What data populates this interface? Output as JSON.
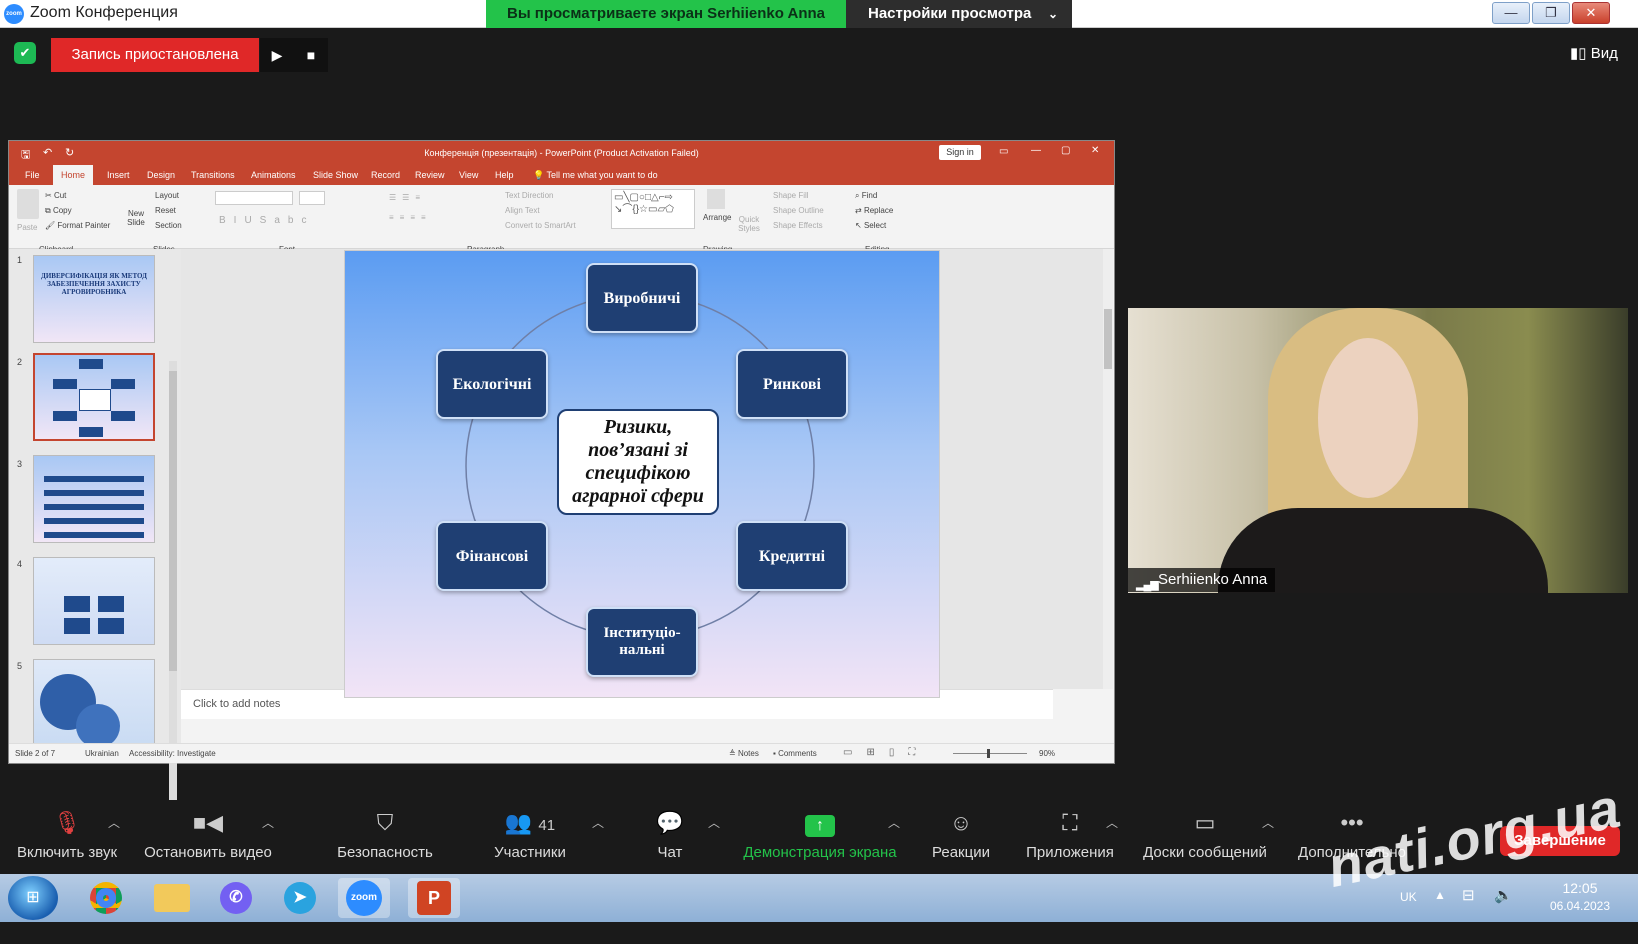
{
  "zoom": {
    "window_title": "Zoom Конференция",
    "logo_text": "zoom",
    "share_banner": "Вы просматриваете экран Serhiienko Anna",
    "view_options": "Настройки просмотра",
    "recording_status": "Запись приостановлена",
    "view_button": "Вид",
    "participant_name": "Serhiienko Anna",
    "participants_count": "41",
    "end_button": "Завершение",
    "toolbar": [
      {
        "label": "Включить звук",
        "icon": "mic-muted-icon"
      },
      {
        "label": "Остановить видео",
        "icon": "video-icon"
      },
      {
        "label": "Безопасность",
        "icon": "shield-icon"
      },
      {
        "label": "Участники",
        "icon": "participants-icon"
      },
      {
        "label": "Чат",
        "icon": "chat-icon"
      },
      {
        "label": "Демонстрация экрана",
        "icon": "share-screen-icon"
      },
      {
        "label": "Реакции",
        "icon": "reactions-icon"
      },
      {
        "label": "Приложения",
        "icon": "apps-icon"
      },
      {
        "label": "Доски сообщений",
        "icon": "whiteboard-icon"
      },
      {
        "label": "Дополнительно",
        "icon": "more-icon"
      }
    ]
  },
  "ppt": {
    "title": "Конференція (презентація) - PowerPoint (Product Activation Failed)",
    "sign_in": "Sign in",
    "tabs": [
      "File",
      "Home",
      "Insert",
      "Design",
      "Transitions",
      "Animations",
      "Slide Show",
      "Record",
      "Review",
      "View",
      "Help",
      "Tell me what you want to do"
    ],
    "active_tab": "Home",
    "ribbon": {
      "clipboard": {
        "group": "Clipboard",
        "paste": "Paste",
        "cut": "Cut",
        "copy": "Copy",
        "format_painter": "Format Painter"
      },
      "slides": {
        "group": "Slides",
        "new_slide": "New Slide",
        "layout": "Layout",
        "reset": "Reset",
        "section": "Section"
      },
      "font": {
        "group": "Font"
      },
      "paragraph": {
        "group": "Paragraph",
        "text_direction": "Text Direction",
        "align_text": "Align Text",
        "smartart": "Convert to SmartArt"
      },
      "drawing": {
        "group": "Drawing",
        "arrange": "Arrange",
        "quick_styles": "Quick Styles",
        "shape_fill": "Shape Fill",
        "shape_outline": "Shape Outline",
        "shape_effects": "Shape Effects"
      },
      "editing": {
        "group": "Editing",
        "find": "Find",
        "replace": "Replace",
        "select": "Select"
      }
    },
    "thumbnails": [
      {
        "num": "1",
        "text": "ДИВЕРСИФІКАЦІЯ ЯК МЕТОД ЗАБЕЗПЕЧЕННЯ ЗАХИСТУ АГРОВИРОБНИКА"
      },
      {
        "num": "2",
        "text": "Ризики, пов'язані зі специфікою аграрної сфери"
      },
      {
        "num": "3",
        "text": ""
      },
      {
        "num": "4",
        "text": ""
      },
      {
        "num": "5",
        "text": ""
      }
    ],
    "slide": {
      "center": "Ризики, пов’язані зі специфікою аграрної сфери",
      "nodes": {
        "top": "Виробничі",
        "top_right": "Ринкові",
        "bottom_right": "Кредитні",
        "bottom": "Інституціо-нальні",
        "bottom_left": "Фінансові",
        "top_left": "Екологічні"
      }
    },
    "notes_placeholder": "Click to add notes",
    "status": {
      "slide": "Slide 2 of 7",
      "language": "Ukrainian",
      "accessibility": "Accessibility: Investigate",
      "notes": "Notes",
      "comments": "Comments",
      "zoom": "90%"
    }
  },
  "taskbar": {
    "apps": [
      "chrome",
      "explorer",
      "viber",
      "telegram",
      "zoom",
      "powerpoint"
    ],
    "zoom_label": "zoom",
    "lang": "UK",
    "time": "12:05",
    "date": "06.04.2023"
  },
  "watermark": "nati.org.ua"
}
